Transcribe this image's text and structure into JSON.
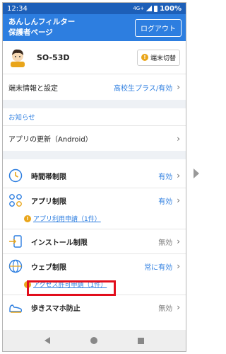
{
  "status_bar": {
    "time": "12:34",
    "network": "4G+",
    "battery": "100%"
  },
  "app_bar": {
    "title_line1": "あんしんフィルター",
    "title_line2": "保護者ページ",
    "logout_label": "ログアウト"
  },
  "device": {
    "name": "SO-53D",
    "switch_label": "端末切替"
  },
  "device_settings": {
    "label": "端末情報と設定",
    "value": "高校生プラス/有効"
  },
  "notice": {
    "header": "お知らせ",
    "item_label": "アプリの更新（Android）"
  },
  "features": {
    "time_limit": {
      "label": "時間帯制限",
      "value": "有効"
    },
    "app_limit": {
      "label": "アプリ制限",
      "value": "有効",
      "request_label": "アプリ利用申請（1件）"
    },
    "install_limit": {
      "label": "インストール制限",
      "value": "無効"
    },
    "web_limit": {
      "label": "ウェブ制限",
      "value": "常に有効",
      "request_label": "アクセス許可申請（1件）"
    },
    "walk_phone": {
      "label": "歩きスマホ防止",
      "value": "無効"
    }
  },
  "colors": {
    "status_bar": "#1d5fb8",
    "app_bar": "#2d7ee0",
    "accent": "#2d7ee0",
    "warning": "#e9a51a",
    "highlight": "#e20e1c"
  }
}
